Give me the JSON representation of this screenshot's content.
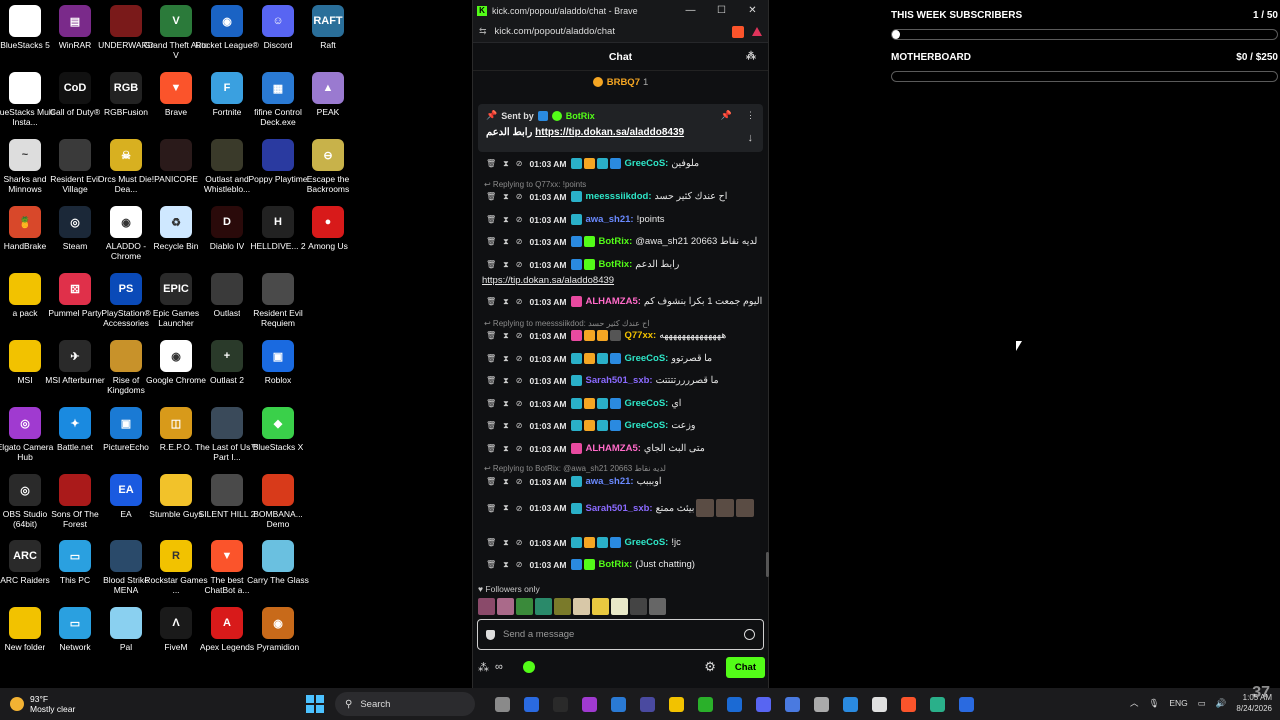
{
  "desktop": {
    "icons": [
      {
        "label": "BlueStacks 5",
        "color": "#ffffff",
        "glyph": ""
      },
      {
        "label": "WinRAR",
        "color": "#7a2a8a",
        "glyph": "▤"
      },
      {
        "label": "UNDERWARD",
        "color": "#7a1a1a",
        "glyph": ""
      },
      {
        "label": "Grand Theft Auto V",
        "color": "#2b7a3a",
        "glyph": "V"
      },
      {
        "label": "Rocket League®",
        "color": "#1a63c4",
        "glyph": "◉"
      },
      {
        "label": "Discord",
        "color": "#5865f2",
        "glyph": "☺"
      },
      {
        "label": "Raft",
        "color": "#2a6f9a",
        "glyph": "RAFT"
      },
      {
        "label": "BlueStacks Multi-Insta...",
        "color": "#ffffff",
        "glyph": ""
      },
      {
        "label": "Call of Duty®",
        "color": "#111111",
        "glyph": "CoD"
      },
      {
        "label": "RGBFusion",
        "color": "#222222",
        "glyph": "RGB"
      },
      {
        "label": "Brave",
        "color": "#fb542b",
        "glyph": "▼"
      },
      {
        "label": "Fortnite",
        "color": "#3aa0e0",
        "glyph": "F"
      },
      {
        "label": "fifine Control Deck.exe",
        "color": "#2a7ad4",
        "glyph": "▦"
      },
      {
        "label": "PEAK",
        "color": "#9a7ad0",
        "glyph": "▲"
      },
      {
        "label": "Sharks and Minnows",
        "color": "#dddddd",
        "glyph": "~"
      },
      {
        "label": "Resident Evil Village",
        "color": "#3a3a3a",
        "glyph": ""
      },
      {
        "label": "Orcs Must Die! Dea...",
        "color": "#d8b020",
        "glyph": "☠"
      },
      {
        "label": "PANICORE",
        "color": "#2a1a1a",
        "glyph": ""
      },
      {
        "label": "Outlast and Whistleblo...",
        "color": "#3a3a2a",
        "glyph": ""
      },
      {
        "label": "Poppy Playtime",
        "color": "#2a3aa0",
        "glyph": ""
      },
      {
        "label": "Escape the Backrooms",
        "color": "#c8b24a",
        "glyph": "⊖"
      },
      {
        "label": "HandBrake",
        "color": "#d8482a",
        "glyph": "🍍"
      },
      {
        "label": "Steam",
        "color": "#1b2838",
        "glyph": "◎"
      },
      {
        "label": "ALADDO - Chrome",
        "color": "#ffffff",
        "glyph": "◉"
      },
      {
        "label": "Recycle Bin",
        "color": "#cfe8ff",
        "glyph": "♻"
      },
      {
        "label": "Diablo IV",
        "color": "#2a0a0a",
        "glyph": "D"
      },
      {
        "label": "HELLDIVE... 2",
        "color": "#222222",
        "glyph": "H"
      },
      {
        "label": "Among Us",
        "color": "#d81a1a",
        "glyph": "●"
      },
      {
        "label": "a pack",
        "color": "#f2c200",
        "glyph": ""
      },
      {
        "label": "Pummel Party",
        "color": "#e0304a",
        "glyph": "⚄"
      },
      {
        "label": "PlayStation® Accessories",
        "color": "#0a4ab8",
        "glyph": "PS"
      },
      {
        "label": "Epic Games Launcher",
        "color": "#2a2a2a",
        "glyph": "EPIC"
      },
      {
        "label": "Outlast",
        "color": "#3a3a3a",
        "glyph": ""
      },
      {
        "label": "Resident Evil Requiem",
        "color": "#4a4a4a",
        "glyph": ""
      },
      {
        "label": "MSI",
        "color": "#f2c200",
        "glyph": ""
      },
      {
        "label": "MSI Afterburner",
        "color": "#2a2a2a",
        "glyph": "✈"
      },
      {
        "label": "Rise of Kingdoms",
        "color": "#c8922a",
        "glyph": ""
      },
      {
        "label": "Google Chrome",
        "color": "#ffffff",
        "glyph": "◉"
      },
      {
        "label": "Outlast 2",
        "color": "#2a3a2a",
        "glyph": "+"
      },
      {
        "label": "Roblox",
        "color": "#1a6ae0",
        "glyph": "▣"
      },
      {
        "label": "Elgato Camera Hub",
        "color": "#a03ad0",
        "glyph": "◎"
      },
      {
        "label": "Battle.net",
        "color": "#1a8ae0",
        "glyph": "✦"
      },
      {
        "label": "PictureEcho",
        "color": "#1a7ad4",
        "glyph": "▣"
      },
      {
        "label": "R.E.P.O.",
        "color": "#d89a1a",
        "glyph": "◫"
      },
      {
        "label": "The Last of Us™ Part I...",
        "color": "#3a4a5a",
        "glyph": ""
      },
      {
        "label": "BlueStacks X",
        "color": "#3ad04a",
        "glyph": "◆"
      },
      {
        "label": "OBS Studio (64bit)",
        "color": "#2a2a2a",
        "glyph": "◎"
      },
      {
        "label": "Sons Of The Forest",
        "color": "#aa1a1a",
        "glyph": ""
      },
      {
        "label": "EA",
        "color": "#1a5ae0",
        "glyph": "EA"
      },
      {
        "label": "Stumble Guys",
        "color": "#f2c22a",
        "glyph": ""
      },
      {
        "label": "SILENT HILL 2",
        "color": "#4a4a4a",
        "glyph": ""
      },
      {
        "label": "BOMBANA... Demo",
        "color": "#d83a1a",
        "glyph": ""
      },
      {
        "label": "ARC Raiders",
        "color": "#2a2a2a",
        "glyph": "ARC"
      },
      {
        "label": "This PC",
        "color": "#2aa0e0",
        "glyph": "▭"
      },
      {
        "label": "Blood Strike MENA",
        "color": "#2a4a6a",
        "glyph": ""
      },
      {
        "label": "Rockstar Games ...",
        "color": "#f2c200",
        "glyph": "R"
      },
      {
        "label": "The best ChatBot a...",
        "color": "#fb542b",
        "glyph": "▼"
      },
      {
        "label": "Carry The Glass",
        "color": "#6ac0e0",
        "glyph": ""
      },
      {
        "label": "New folder",
        "color": "#f2c200",
        "glyph": ""
      },
      {
        "label": "Network",
        "color": "#2aa0e0",
        "glyph": "▭"
      },
      {
        "label": "Pal",
        "color": "#8ad0f0",
        "glyph": ""
      },
      {
        "label": "FiveM",
        "color": "#1a1a1a",
        "glyph": "Λ"
      },
      {
        "label": "Apex Legends",
        "color": "#d81a1a",
        "glyph": "A"
      },
      {
        "label": "Pyramidion",
        "color": "#c86a1a",
        "glyph": "◉"
      }
    ]
  },
  "browser": {
    "title": "kick.com/popout/aladdo/chat - Brave",
    "url": "kick.com/popout/aladdo/chat",
    "chat_header": "Chat",
    "top_user": "BRBQ7",
    "top_user_count": "1",
    "pinned": {
      "sent_by_label": "Sent by",
      "sender": "BotRix",
      "text_prefix": "رابط الدعم",
      "link": "https://tip.dokan.sa/aladdo8439"
    },
    "messages": [
      {
        "time": "01:03 AM",
        "user": "GreeCoS",
        "user_color": "#2ee6c8",
        "text": "ملوفين",
        "badges": [
          "#2ab0c8",
          "#f5a623",
          "#2ab0c8",
          "#2a8ae0"
        ]
      },
      {
        "reply": "Replying to Q77xx: !points"
      },
      {
        "time": "01:03 AM",
        "user": "meesssiikdod",
        "user_color": "#2ee6c8",
        "text": "اح عندك كثير حسد",
        "badges": [
          "#2ab0c8"
        ]
      },
      {
        "time": "01:03 AM",
        "user": "awa_sh21",
        "user_color": "#6a8aff",
        "text": "!points",
        "badges": [
          "#2ab0c8"
        ]
      },
      {
        "time": "01:03 AM",
        "user": "BotRix",
        "user_color": "#53fc18",
        "text": "@awa_sh21 20663 لديه نقاط",
        "badges": [
          "#2a8ae0",
          "#53fc18"
        ]
      },
      {
        "time": "01:03 AM",
        "user": "BotRix",
        "user_color": "#53fc18",
        "text": "رابط الدعم",
        "badges": [
          "#2a8ae0",
          "#53fc18"
        ]
      },
      {
        "link": "https://tip.dokan.sa/aladdo8439"
      },
      {
        "time": "01:03 AM",
        "user": "ALHAMZA5",
        "user_color": "#ff6ac8",
        "text": "اليوم جمعت 1 بكرا بنشوف كم",
        "badges": [
          "#e84aa0"
        ]
      },
      {
        "reply": "Replying to meesssiikdod: اح عندك كثير حسد"
      },
      {
        "time": "01:03 AM",
        "user": "Q77xx",
        "user_color": "#f2c200",
        "text": "ههههههههههههههه",
        "badges": [
          "#e84aa0",
          "#f5a623",
          "#f5a623",
          "#555555"
        ]
      },
      {
        "time": "01:03 AM",
        "user": "GreeCoS",
        "user_color": "#2ee6c8",
        "text": "ما قصرتوو",
        "badges": [
          "#2ab0c8",
          "#f5a623",
          "#2ab0c8",
          "#2a8ae0"
        ]
      },
      {
        "time": "01:03 AM",
        "user": "Sarah501_sxb",
        "user_color": "#8a6aff",
        "text": "ما قصررررتتتتت",
        "badges": [
          "#2ab0c8"
        ]
      },
      {
        "time": "01:03 AM",
        "user": "GreeCoS",
        "user_color": "#2ee6c8",
        "text": "اي",
        "badges": [
          "#2ab0c8",
          "#f5a623",
          "#2ab0c8",
          "#2a8ae0"
        ]
      },
      {
        "time": "01:03 AM",
        "user": "GreeCoS",
        "user_color": "#2ee6c8",
        "text": "وزعت",
        "badges": [
          "#2ab0c8",
          "#f5a623",
          "#2ab0c8",
          "#2a8ae0"
        ]
      },
      {
        "time": "01:03 AM",
        "user": "ALHAMZA5",
        "user_color": "#ff6ac8",
        "text": "متى البث الجاي",
        "badges": [
          "#e84aa0"
        ]
      },
      {
        "reply": "Replying to BotRix: @awa_sh21 20663 لديه نقاط"
      },
      {
        "time": "01:03 AM",
        "user": "awa_sh21",
        "user_color": "#6a8aff",
        "text": "اوبببب",
        "badges": [
          "#2ab0c8"
        ]
      },
      {
        "time": "01:03 AM",
        "user": "Sarah501_sxb",
        "user_color": "#8a6aff",
        "text": "بيئث ممتع",
        "badges": [
          "#2ab0c8"
        ],
        "emotes": 3
      },
      {
        "time": "01:03 AM",
        "user": "GreeCoS",
        "user_color": "#2ee6c8",
        "text": "!jc",
        "badges": [
          "#2ab0c8",
          "#f5a623",
          "#2ab0c8",
          "#2a8ae0"
        ]
      },
      {
        "time": "01:03 AM",
        "user": "BotRix",
        "user_color": "#53fc18",
        "text": "(Just chatting)",
        "badges": [
          "#2a8ae0",
          "#53fc18"
        ]
      }
    ],
    "followers_only": "Followers only",
    "emote_colors": [
      "#8a4a6a",
      "#aa6a8a",
      "#3a8a3a",
      "#2a8a6a",
      "#7a7a2a",
      "#d8c8a8",
      "#e8c840",
      "#e8e8c8",
      "#444444",
      "#666666"
    ],
    "input_placeholder": "Send a message",
    "chat_button": "Chat"
  },
  "goals": [
    {
      "title": "THIS WEEK SUBSCRIBERS",
      "value": "1 / 50",
      "progress": 0.02
    },
    {
      "title": "MOTHERBOARD",
      "value": "$0 / $250",
      "progress": 0
    }
  ],
  "taskbar": {
    "temperature": "93°F",
    "condition": "Mostly clear",
    "search": "Search",
    "app_colors": [
      "#8a8a8a",
      "#2a6ae0",
      "#2a2a2a",
      "#a03ad0",
      "#2a7ad4",
      "#4a4aa0",
      "#f2c200",
      "#2ab02a",
      "#1b6ad4",
      "#5865f2",
      "#4a7ae0",
      "#aaaaaa",
      "#2a8ae0",
      "#e0e0e0",
      "#fb542b",
      "#2ab08a",
      "#2a6ae0"
    ],
    "language": "ENG",
    "time": "1:05 AM",
    "date": "8/24/2026"
  },
  "watermark": "37"
}
